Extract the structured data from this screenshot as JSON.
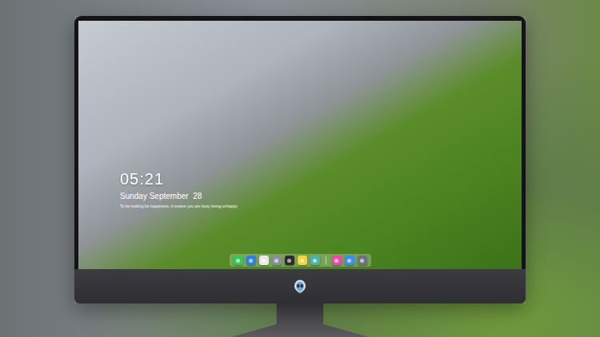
{
  "desktop": {
    "clock": {
      "time": "05:21",
      "date": "Sunday September  28",
      "quote": "To be looking for happiness, it means you are busy being unhappy"
    },
    "dock": {
      "items": [
        {
          "kind": "app",
          "color": "#34c759"
        },
        {
          "kind": "app",
          "color": "#2f7fe0"
        },
        {
          "kind": "app",
          "color": "#e9e9ea"
        },
        {
          "kind": "app",
          "color": "#8a9099"
        },
        {
          "kind": "app",
          "color": "#2c2c2e"
        },
        {
          "kind": "app",
          "color": "#f5d33f"
        },
        {
          "kind": "app",
          "color": "#4fb3a8"
        },
        {
          "kind": "separator",
          "color": "#ffffff"
        },
        {
          "kind": "app",
          "color": "#ea4ca8"
        },
        {
          "kind": "app",
          "color": "#3b8ff0"
        },
        {
          "kind": "app",
          "color": "#6e7379"
        }
      ]
    }
  }
}
